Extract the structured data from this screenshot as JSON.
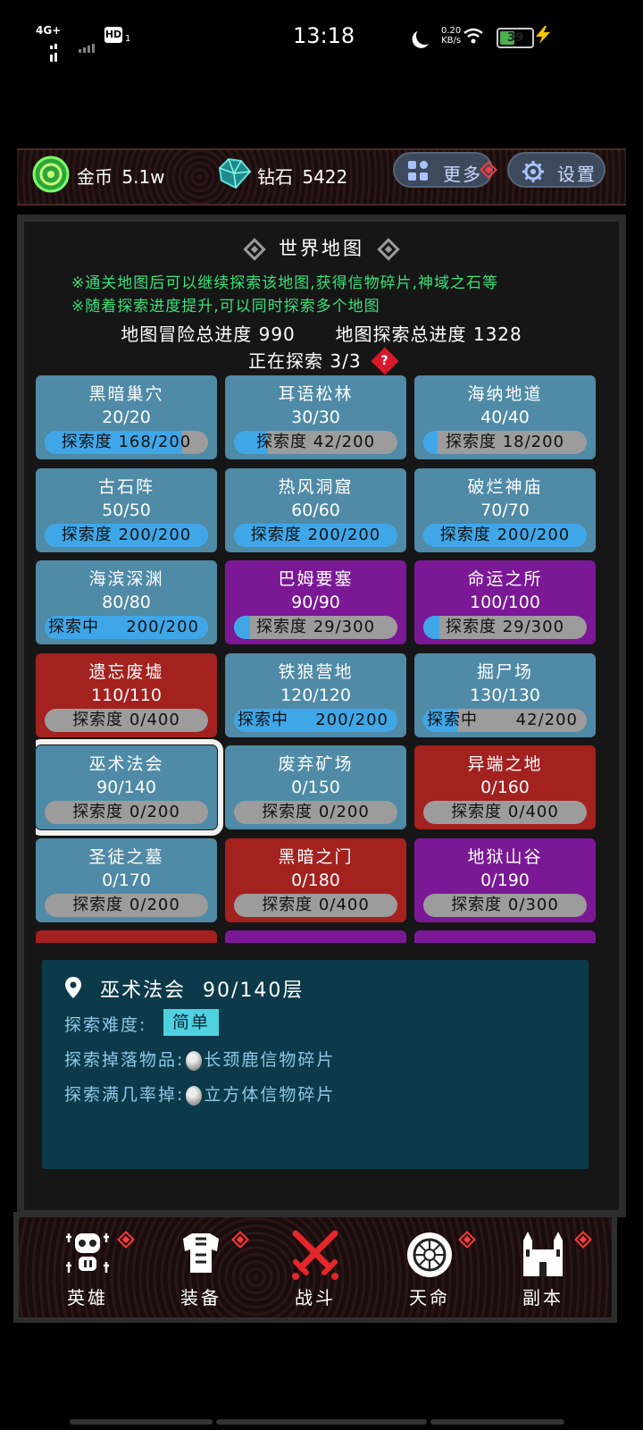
{
  "status_bar": {
    "network": "4G+",
    "hd": "HD",
    "sim2": "1",
    "time": "13:18",
    "speed_value": "0.20",
    "speed_unit": "KB/s",
    "battery": "39"
  },
  "resources": {
    "gold_label": "金币",
    "gold_value": "5.1w",
    "diamond_label": "钻石",
    "diamond_value": "5422",
    "more_button": "更多",
    "settings_button": "设置"
  },
  "world_map": {
    "title": "世界地图",
    "tips": [
      "※通关地图后可以继续探索该地图,获得信物碎片,神域之石等",
      "※随着探索进度提升,可以同时探索多个地图"
    ],
    "adventure_total_label": "地图冒险总进度",
    "adventure_total": "990",
    "explore_total_label": "地图探索总进度",
    "explore_total": "1328",
    "exploring_label": "正在探索",
    "exploring_count": "3/3",
    "help_mark": "?"
  },
  "maps": [
    {
      "name": "黑暗巢穴",
      "level": "20/20",
      "bar_label": "探索度",
      "bar_value": "168/200",
      "progress": 0.84,
      "theme": "blue",
      "mode": "inline"
    },
    {
      "name": "耳语松林",
      "level": "30/30",
      "bar_label": "探索度",
      "bar_value": "42/200",
      "progress": 0.21,
      "theme": "blue",
      "mode": "inline"
    },
    {
      "name": "海纳地道",
      "level": "40/40",
      "bar_label": "探索度",
      "bar_value": "18/200",
      "progress": 0.09,
      "theme": "blue",
      "mode": "inline"
    },
    {
      "name": "古石阵",
      "level": "50/50",
      "bar_label": "探索度",
      "bar_value": "200/200",
      "progress": 1.0,
      "theme": "blue",
      "mode": "inline"
    },
    {
      "name": "热风洞窟",
      "level": "60/60",
      "bar_label": "探索度",
      "bar_value": "200/200",
      "progress": 1.0,
      "theme": "blue",
      "mode": "inline"
    },
    {
      "name": "破烂神庙",
      "level": "70/70",
      "bar_label": "探索度",
      "bar_value": "200/200",
      "progress": 1.0,
      "theme": "blue",
      "mode": "inline"
    },
    {
      "name": "海滨深渊",
      "level": "80/80",
      "bar_label": "探索中",
      "bar_value": "200/200",
      "progress": 1.0,
      "theme": "blue",
      "mode": "split"
    },
    {
      "name": "巴姆要塞",
      "level": "90/90",
      "bar_label": "探索度",
      "bar_value": "29/300",
      "progress": 0.0967,
      "theme": "purple",
      "mode": "inline"
    },
    {
      "name": "命运之所",
      "level": "100/100",
      "bar_label": "探索度",
      "bar_value": "29/300",
      "progress": 0.0967,
      "theme": "purple",
      "mode": "inline"
    },
    {
      "name": "遗忘废墟",
      "level": "110/110",
      "bar_label": "探索度",
      "bar_value": "0/400",
      "progress": 0,
      "theme": "red",
      "mode": "inline"
    },
    {
      "name": "铁狼营地",
      "level": "120/120",
      "bar_label": "探索中",
      "bar_value": "200/200",
      "progress": 1.0,
      "theme": "blue",
      "mode": "split"
    },
    {
      "name": "掘尸场",
      "level": "130/130",
      "bar_label": "探索中",
      "bar_value": "42/200",
      "progress": 0.21,
      "theme": "blue",
      "mode": "split"
    },
    {
      "name": "巫术法会",
      "level": "90/140",
      "bar_label": "探索度",
      "bar_value": "0/200",
      "progress": 0,
      "theme": "blue",
      "mode": "inline",
      "selected": true
    },
    {
      "name": "废弃矿场",
      "level": "0/150",
      "bar_label": "探索度",
      "bar_value": "0/200",
      "progress": 0,
      "theme": "blue",
      "mode": "inline"
    },
    {
      "name": "异端之地",
      "level": "0/160",
      "bar_label": "探索度",
      "bar_value": "0/400",
      "progress": 0,
      "theme": "red",
      "mode": "inline"
    },
    {
      "name": "圣徒之墓",
      "level": "0/170",
      "bar_label": "探索度",
      "bar_value": "0/200",
      "progress": 0,
      "theme": "blue",
      "mode": "inline"
    },
    {
      "name": "黑暗之门",
      "level": "0/180",
      "bar_label": "探索度",
      "bar_value": "0/400",
      "progress": 0,
      "theme": "red",
      "mode": "inline"
    },
    {
      "name": "地狱山谷",
      "level": "0/190",
      "bar_label": "探索度",
      "bar_value": "0/300",
      "progress": 0,
      "theme": "purple",
      "mode": "inline"
    },
    {
      "name": "",
      "level": "",
      "bar_label": "",
      "bar_value": "",
      "progress": 0,
      "theme": "red",
      "mode": "inline"
    },
    {
      "name": "",
      "level": "",
      "bar_label": "",
      "bar_value": "",
      "progress": 0,
      "theme": "purple",
      "mode": "inline"
    },
    {
      "name": "",
      "level": "",
      "bar_label": "",
      "bar_value": "",
      "progress": 0,
      "theme": "purple",
      "mode": "inline"
    }
  ],
  "theme_colors": {
    "blue": "#4f8aa6",
    "purple": "#7b1896",
    "red": "#a3211f",
    "bar_fill": "#3fa7e8",
    "bar_bg": "#9c9c9c"
  },
  "detail": {
    "map_name": "巫术法会",
    "floor": "90/140层",
    "difficulty_label": "探索难度:",
    "difficulty": "简单",
    "drop_label": "探索掉落物品:",
    "drop_item": "长颈鹿信物碎片",
    "full_drop_label": "探索满几率掉:",
    "full_drop_item": "立方体信物碎片"
  },
  "bottom_nav": [
    {
      "label": "英雄",
      "icon": "hero-icon",
      "dot": true
    },
    {
      "label": "装备",
      "icon": "armor-icon",
      "dot": true
    },
    {
      "label": "战斗",
      "icon": "crossed-swords-icon",
      "dot": false
    },
    {
      "label": "天命",
      "icon": "destiny-icon",
      "dot": true
    },
    {
      "label": "副本",
      "icon": "castle-icon",
      "dot": true
    }
  ]
}
